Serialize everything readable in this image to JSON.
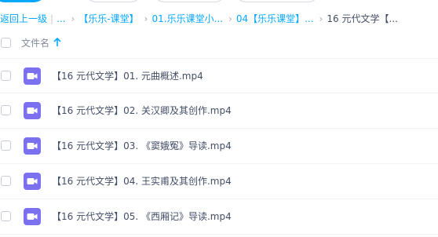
{
  "breadcrumb": {
    "back_label": "返回上一级",
    "separator": "|",
    "ellipsis": "...",
    "chevron": "›",
    "items": [
      "【乐乐-课堂】",
      "01.乐乐课堂小...",
      "04【乐乐课堂】...",
      "16 元代文学【..."
    ]
  },
  "file_list": {
    "header_label": "文件名",
    "sort": "ascending",
    "files": [
      {
        "name": "【16 元代文学】01. 元曲概述.mp4",
        "type": "video"
      },
      {
        "name": "【16 元代文学】02. 关汉卿及其创作.mp4",
        "type": "video"
      },
      {
        "name": "【16 元代文学】03. 《窦娥冤》导读.mp4",
        "type": "video"
      },
      {
        "name": "【16 元代文学】04. 王实甫及其创作.mp4",
        "type": "video"
      },
      {
        "name": "【16 元代文学】05. 《西厢记》导读.mp4",
        "type": "video"
      }
    ]
  },
  "icons": {
    "video_icon": "video-file-icon",
    "sort_icon": "arrow-up-icon"
  },
  "colors": {
    "accent": "#06a7ff",
    "video_icon": "#7a70f0",
    "text": "#424e67",
    "muted": "#818999"
  }
}
